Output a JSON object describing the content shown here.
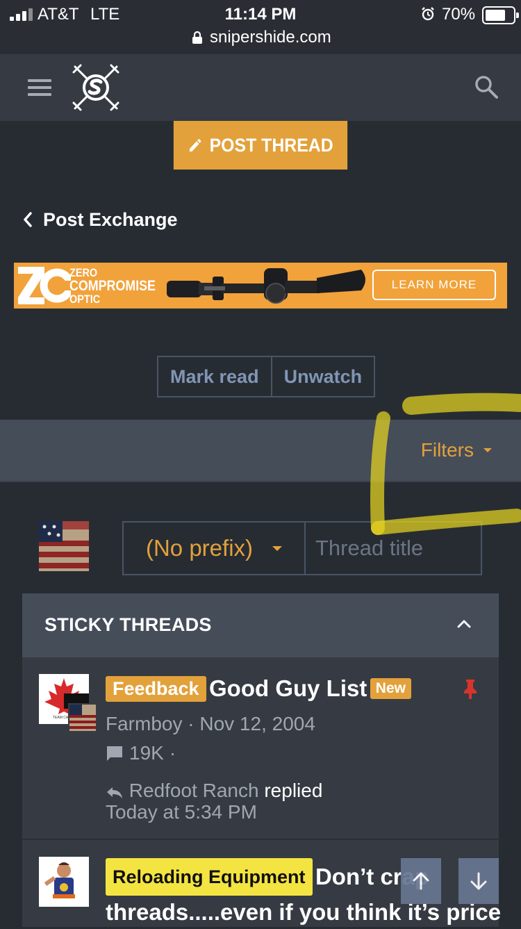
{
  "status_bar": {
    "carrier": "AT&T",
    "network": "LTE",
    "time": "11:14 PM",
    "battery": "70%",
    "url": "snipershide.com"
  },
  "header": {
    "menu_icon": "hamburger-icon",
    "logo_icon": "snipershide-logo",
    "search_icon": "search-icon"
  },
  "actions": {
    "post_thread": "POST THREAD"
  },
  "breadcrumb": {
    "label": "Post Exchange"
  },
  "ad": {
    "brand_lines": [
      "ZERO",
      "COMPROMISE",
      "OPTIC"
    ],
    "cta": "LEARN MORE"
  },
  "buttons": {
    "mark_read": "Mark read",
    "unwatch": "Unwatch"
  },
  "filters": {
    "label": "Filters"
  },
  "new_thread": {
    "prefix": "(No prefix)",
    "title_placeholder": "Thread title"
  },
  "sticky": {
    "heading": "STICKY THREADS",
    "threads": [
      {
        "label": "Feedback",
        "title": "Good Guy List",
        "badge": "New",
        "author": "Farmboy",
        "date": "Nov 12, 2004",
        "replies": "19K",
        "last_poster": "Redfoot Ranch",
        "replied_word": "replied",
        "last_time": "Today at 5:34 PM"
      },
      {
        "label": "Reloading Equipment",
        "title_line1": "Don’t crap",
        "title_line2": "threads.....even if you think it’s price"
      }
    ]
  },
  "colors": {
    "accent": "#e3a13b",
    "background": "#272c33",
    "panel": "#363b43",
    "filter_bar": "#454d59",
    "link_blue": "#8096b4",
    "reloading_label": "#f4e441",
    "pin_red": "#d9342b",
    "highlight_marker": "#e6d41f"
  }
}
